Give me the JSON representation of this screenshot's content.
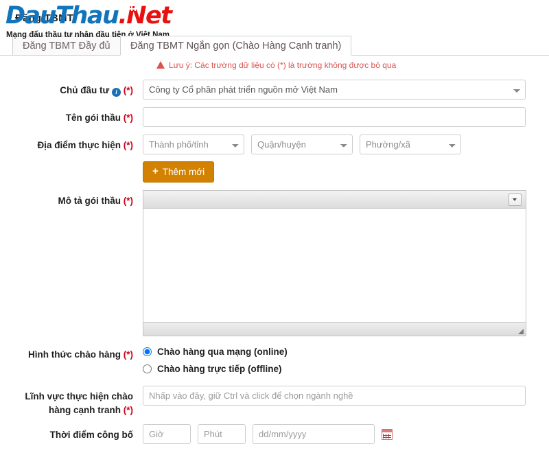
{
  "header": {
    "overlap_title": "Đăng TBMT",
    "logo": {
      "part1": "Dau",
      "part2": "Thau",
      "dot": ".",
      "part3": "N",
      "part4": "et"
    },
    "tagline": "Mạng đấu thầu tư nhân đầu tiên ở Việt Nam"
  },
  "tabs": [
    {
      "label": "Đăng TBMT Đầy đủ",
      "active": false
    },
    {
      "label": "Đăng TBMT Ngắn gọn (Chào Hàng Cạnh tranh)",
      "active": true
    }
  ],
  "form": {
    "notice": "Lưu ý: Các trường dữ liệu có (*) là trường không được bỏ qua",
    "required_mark": "(*)",
    "investor": {
      "label": "Chủ đầu tư",
      "info_glyph": "i",
      "value": "Công ty Cổ phần phát triển nguồn mở Việt Nam"
    },
    "package_name": {
      "label": "Tên gói thầu",
      "value": "",
      "placeholder": ""
    },
    "location": {
      "label": "Địa điểm thực hiện",
      "province_placeholder": "Thành phố/tỉnh",
      "district_placeholder": "Quận/huyện",
      "ward_placeholder": "Phường/xã",
      "add_button": "Thêm mới",
      "add_button_icon": "plus-icon"
    },
    "description": {
      "label": "Mô tả gói thầu",
      "value": "",
      "menu_icon": "chevron-down-icon",
      "resize_icon": "resize-grip-icon"
    },
    "offer_type": {
      "label": "Hình thức chào hàng",
      "options": [
        {
          "label": "Chào hàng qua mạng (online)",
          "selected": true
        },
        {
          "label": "Chào hàng trực tiếp (offline)",
          "selected": false
        }
      ]
    },
    "sector": {
      "label_line1": "Lĩnh vực thực hiện chào",
      "label_line2": "hàng cạnh tranh",
      "value": "",
      "placeholder": "Nhấp vào đây, giữ Ctrl và click để chọn ngành nghề"
    },
    "publish_time": {
      "label": "Thời điểm công bố",
      "hour_placeholder": "Giờ",
      "minute_placeholder": "Phút",
      "date_placeholder": "dd/mm/yyyy",
      "hour_value": "",
      "minute_value": "",
      "date_value": "",
      "calendar_icon": "calendar-icon"
    }
  },
  "colors": {
    "brand_blue": "#1275bc",
    "brand_red": "#e8110f",
    "required_red": "#d0021b",
    "notice_red": "#d9534f",
    "button_orange": "#d38100",
    "radio_blue": "#1a6fb5"
  }
}
